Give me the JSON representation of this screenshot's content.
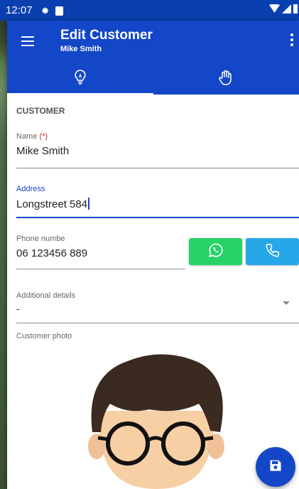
{
  "status_bar": {
    "time": "12:07"
  },
  "appbar": {
    "title": "Edit Customer",
    "subtitle": "Mike Smith",
    "tabs": [
      {
        "icon": "lightbulb-icon",
        "active": true
      },
      {
        "icon": "hand-icon",
        "active": false
      }
    ]
  },
  "form": {
    "section_title": "CUSTOMER",
    "name": {
      "label": "Name",
      "required_mark": "(*)",
      "value": "Mike Smith"
    },
    "address": {
      "label": "Address",
      "value": "Longstreet 584"
    },
    "phone": {
      "label": "Phone numbe",
      "value": "06 123456 889"
    },
    "details": {
      "label": "Additional details",
      "value": "-"
    },
    "photo": {
      "label": "Customer photo"
    }
  },
  "colors": {
    "primary": "#1447c8",
    "whatsapp": "#25d366",
    "call": "#26a8e8"
  }
}
